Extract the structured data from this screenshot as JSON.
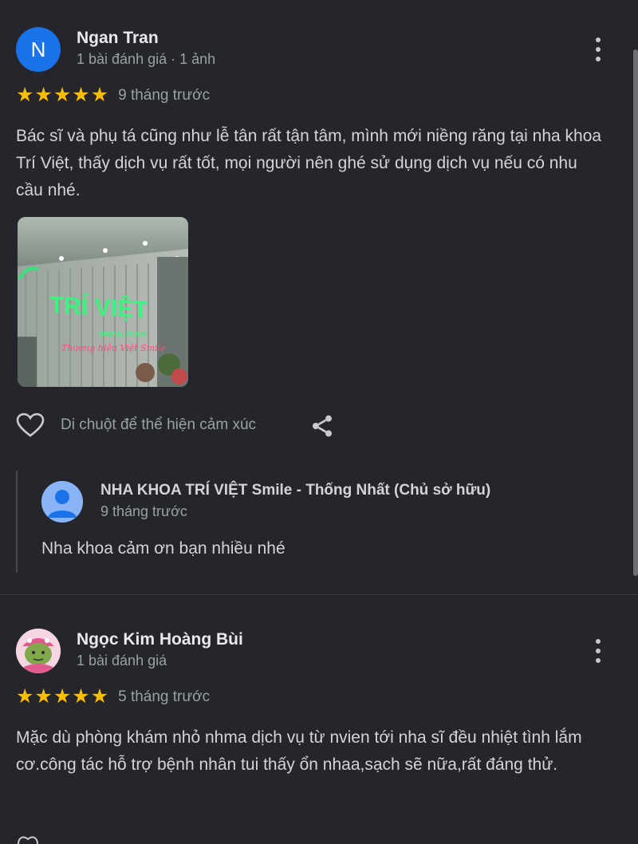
{
  "reviews": [
    {
      "avatar_letter": "N",
      "avatar_color": "#1a73e8",
      "name": "Ngan Tran",
      "meta": "1 bài đánh giá · 1 ảnh",
      "rating": 5,
      "time": "9 tháng trước",
      "text": "Bác sĩ và phụ tá cũng như lễ tân rất tận tâm, mình mới niềng răng tại nha khoa Trí Việt, thấy dịch vụ rất tốt, mọi người nên ghé sử dụng dịch vụ nếu có nhu cầu nhé.",
      "photo": {
        "sign_text": "TRÍ VIỆT",
        "sub_text": "DENTAL CLINIC",
        "script_text": "Thương hiệu Việt Smile"
      },
      "react_label": "Di chuột để thể hiện cảm xúc",
      "owner_reply": {
        "name": "NHA KHOA TRÍ VIỆT Smile - Thống Nhất (Chủ sở hữu)",
        "time": "9 tháng trước",
        "text": "Nha khoa cảm ơn bạn nhiều nhé"
      }
    },
    {
      "name": "Ngọc Kim Hoàng Bùi",
      "meta": "1 bài đánh giá",
      "rating": 5,
      "time": "5 tháng trước",
      "text": "Mặc dù phòng khám nhỏ nhma dịch vụ từ nvien tới nha sĩ đều nhiệt tình lắm cơ.công tác hỗ trợ bệnh nhân tui thấy ổn nhaa,sạch sẽ nữa,rất đáng thử."
    }
  ],
  "colors": {
    "background": "#25262b",
    "star": "#fbbc04",
    "accent": "#1a73e8"
  }
}
